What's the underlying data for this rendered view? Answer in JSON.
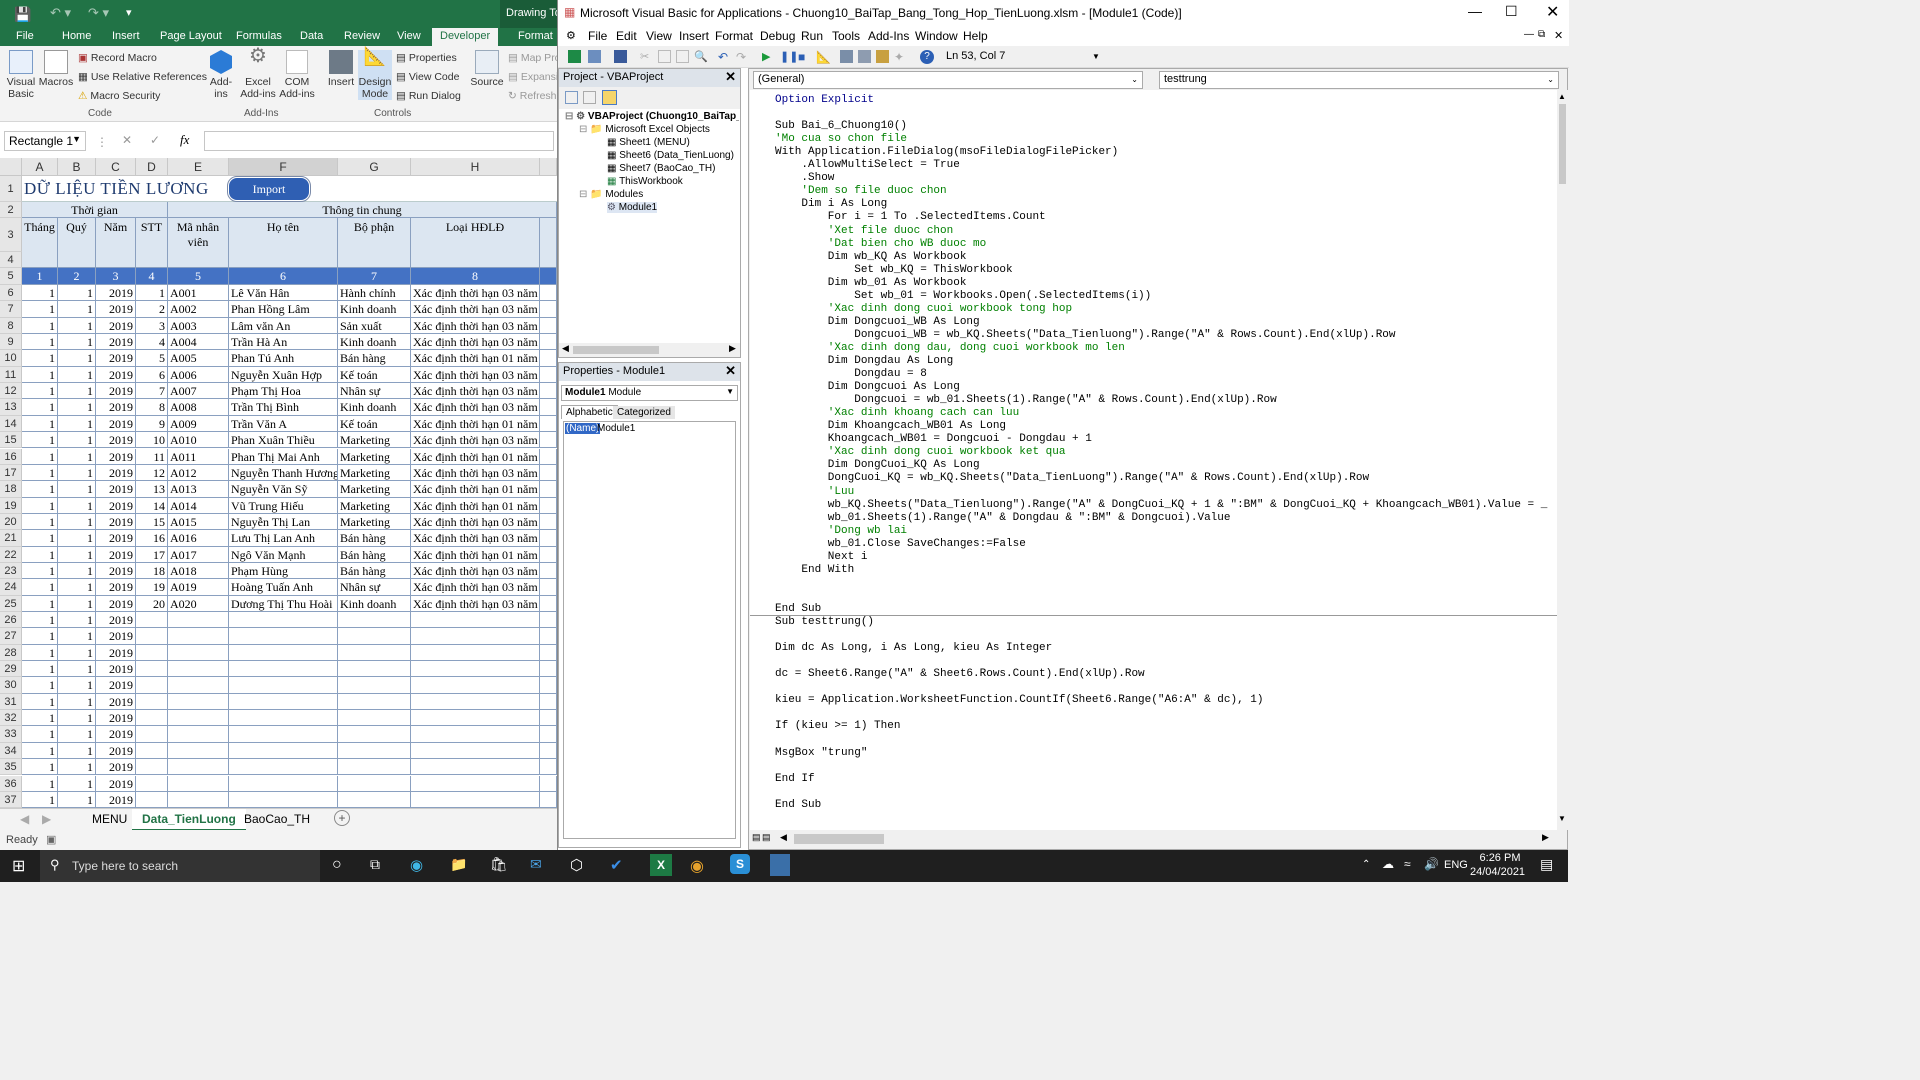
{
  "excel": {
    "title_partial": "Drawing To...",
    "tabs": [
      "File",
      "Home",
      "Insert",
      "Page Layout",
      "Formulas",
      "Data",
      "Review",
      "View",
      "Developer",
      "Format"
    ],
    "active_tab": "Developer",
    "ribbon": {
      "visual_basic": "Visual Basic",
      "macros": "Macros",
      "record_macro": "Record Macro",
      "relative_refs": "Use Relative References",
      "macro_security": "Macro Security",
      "group_code": "Code",
      "addins": "Add-ins",
      "excel_addins": "Excel Add-ins",
      "com_addins": "COM Add-ins",
      "group_addins": "Add-Ins",
      "insert": "Insert",
      "design_mode": "Design Mode",
      "properties": "Properties",
      "view_code": "View Code",
      "run_dialog": "Run Dialog",
      "group_controls": "Controls",
      "source": "Source",
      "map_props": "Map Pro",
      "expansion": "Expansi",
      "refresh": "Refresh"
    },
    "name_box": "Rectangle 1",
    "fx": "fx",
    "columns": [
      "A",
      "B",
      "C",
      "D",
      "E",
      "F",
      "G",
      "H"
    ],
    "sheet_title": "DỮ LIỆU TIỀN LƯƠNG",
    "import_button": "Import",
    "group_time": "Thời gian",
    "group_info": "Thông tin chung",
    "headers": [
      "Tháng",
      "Quý",
      "Năm",
      "STT",
      "Mã nhân viên",
      "Họ tên",
      "Bộ phận",
      "Loại HĐLĐ"
    ],
    "col_numbers": [
      "1",
      "2",
      "3",
      "4",
      "5",
      "6",
      "7",
      "8"
    ],
    "rows": [
      [
        "1",
        "1",
        "2019",
        "1",
        "A001",
        "Lê Văn Hân",
        "Hành chính",
        "Xác định thời hạn 03 năm"
      ],
      [
        "1",
        "1",
        "2019",
        "2",
        "A002",
        "Phan Hồng Lâm",
        "Kinh doanh",
        "Xác định thời hạn 03 năm"
      ],
      [
        "1",
        "1",
        "2019",
        "3",
        "A003",
        "Lâm văn An",
        "Sản xuất",
        "Xác định thời hạn 03 năm"
      ],
      [
        "1",
        "1",
        "2019",
        "4",
        "A004",
        "Trần Hà An",
        "Kinh doanh",
        "Xác định thời hạn 03 năm"
      ],
      [
        "1",
        "1",
        "2019",
        "5",
        "A005",
        "Phan Tú Anh",
        "Bán hàng",
        "Xác định thời hạn 01 năm"
      ],
      [
        "1",
        "1",
        "2019",
        "6",
        "A006",
        "Nguyễn Xuân Hợp",
        "Kế toán",
        "Xác định thời hạn 03 năm"
      ],
      [
        "1",
        "1",
        "2019",
        "7",
        "A007",
        "Phạm Thị Hoa",
        "Nhân sự",
        "Xác định thời hạn 03 năm"
      ],
      [
        "1",
        "1",
        "2019",
        "8",
        "A008",
        "Trần Thị Bình",
        "Kinh doanh",
        "Xác định thời hạn 03 năm"
      ],
      [
        "1",
        "1",
        "2019",
        "9",
        "A009",
        "Trần Văn A",
        "Kế toán",
        "Xác định thời hạn 01 năm"
      ],
      [
        "1",
        "1",
        "2019",
        "10",
        "A010",
        "Phan Xuân Thiều",
        "Marketing",
        "Xác định thời hạn 03 năm"
      ],
      [
        "1",
        "1",
        "2019",
        "11",
        "A011",
        "Phan Thị Mai Anh",
        "Marketing",
        "Xác định thời hạn 01 năm"
      ],
      [
        "1",
        "1",
        "2019",
        "12",
        "A012",
        "Nguyễn Thanh Hương",
        "Marketing",
        "Xác định thời hạn 03 năm"
      ],
      [
        "1",
        "1",
        "2019",
        "13",
        "A013",
        "Nguyễn Văn Sỹ",
        "Marketing",
        "Xác định thời hạn 01 năm"
      ],
      [
        "1",
        "1",
        "2019",
        "14",
        "A014",
        "Vũ Trung Hiếu",
        "Marketing",
        "Xác định thời hạn 01 năm"
      ],
      [
        "1",
        "1",
        "2019",
        "15",
        "A015",
        "Nguyễn Thị Lan",
        "Marketing",
        "Xác định thời hạn 03 năm"
      ],
      [
        "1",
        "1",
        "2019",
        "16",
        "A016",
        "Lưu Thị Lan Anh",
        "Bán hàng",
        "Xác định thời hạn 03 năm"
      ],
      [
        "1",
        "1",
        "2019",
        "17",
        "A017",
        "Ngô Văn Mạnh",
        "Bán hàng",
        "Xác định thời hạn 01 năm"
      ],
      [
        "1",
        "1",
        "2019",
        "18",
        "A018",
        "Phạm Hùng",
        "Bán hàng",
        "Xác định thời hạn 03 năm"
      ],
      [
        "1",
        "1",
        "2019",
        "19",
        "A019",
        "Hoàng Tuấn Anh",
        "Nhân sự",
        "Xác định thời hạn 03 năm"
      ],
      [
        "1",
        "1",
        "2019",
        "20",
        "A020",
        "Dương Thị Thu Hoài",
        "Kinh doanh",
        "Xác định thời hạn 03 năm"
      ],
      [
        "1",
        "1",
        "2019",
        "",
        "",
        "",
        "",
        ""
      ],
      [
        "1",
        "1",
        "2019",
        "",
        "",
        "",
        "",
        ""
      ],
      [
        "1",
        "1",
        "2019",
        "",
        "",
        "",
        "",
        ""
      ],
      [
        "1",
        "1",
        "2019",
        "",
        "",
        "",
        "",
        ""
      ],
      [
        "1",
        "1",
        "2019",
        "",
        "",
        "",
        "",
        ""
      ],
      [
        "1",
        "1",
        "2019",
        "",
        "",
        "",
        "",
        ""
      ],
      [
        "1",
        "1",
        "2019",
        "",
        "",
        "",
        "",
        ""
      ],
      [
        "1",
        "1",
        "2019",
        "",
        "",
        "",
        "",
        ""
      ],
      [
        "1",
        "1",
        "2019",
        "",
        "",
        "",
        "",
        ""
      ],
      [
        "1",
        "1",
        "2019",
        "",
        "",
        "",
        "",
        ""
      ],
      [
        "1",
        "1",
        "2019",
        "",
        "",
        "",
        "",
        ""
      ],
      [
        "1",
        "1",
        "2019",
        "",
        "",
        "",
        "",
        ""
      ]
    ],
    "row_numbers": [
      "1",
      "2",
      "3",
      "4",
      "5",
      "6",
      "7",
      "8",
      "9",
      "10",
      "11",
      "12",
      "13",
      "14",
      "15",
      "16",
      "17",
      "18",
      "19",
      "20",
      "21",
      "22",
      "23",
      "24",
      "25",
      "26",
      "27",
      "28",
      "29",
      "30",
      "31",
      "32",
      "33",
      "34",
      "35",
      "36",
      "37"
    ],
    "sheet_tabs": [
      "MENU",
      "Data_TienLuong",
      "BaoCao_TH"
    ],
    "active_sheet": "Data_TienLuong",
    "status": "Ready"
  },
  "vba": {
    "title": "Microsoft Visual Basic for Applications - Chuong10_BaiTap_Bang_Tong_Hop_TienLuong.xlsm - [Module1 (Code)]",
    "menu": [
      "File",
      "Edit",
      "View",
      "Insert",
      "Format",
      "Debug",
      "Run",
      "Tools",
      "Add-Ins",
      "Window",
      "Help"
    ],
    "cursor_pos": "Ln 53, Col 7",
    "project_title": "Project - VBAProject",
    "tree": {
      "root": "VBAProject (Chuong10_BaiTap_",
      "objects_folder": "Microsoft Excel Objects",
      "sheets": [
        "Sheet1 (MENU)",
        "Sheet6 (Data_TienLuong)",
        "Sheet7 (BaoCao_TH)",
        "ThisWorkbook"
      ],
      "modules_folder": "Modules",
      "module": "Module1"
    },
    "props_title": "Properties - Module1",
    "props_combo_bold": "Module1",
    "props_combo_rest": "Module",
    "props_tabs": [
      "Alphabetic",
      "Categorized"
    ],
    "props_name_key": "(Name)",
    "props_name_val": "Module1",
    "combo_left": "(General)",
    "combo_right": "testtrung",
    "code_lines": [
      {
        "t": "Option Explicit",
        "c": "kw"
      },
      {
        "t": "",
        "c": ""
      },
      {
        "t": "Sub Bai_6_Chuong10()",
        "c": ""
      },
      {
        "t": "'Mo cua so chon file",
        "c": "cm"
      },
      {
        "t": "With Application.FileDialog(msoFileDialogFilePicker)",
        "c": ""
      },
      {
        "t": "    .AllowMultiSelect = True",
        "c": ""
      },
      {
        "t": "    .Show",
        "c": ""
      },
      {
        "t": "    'Dem so file duoc chon",
        "c": "cm"
      },
      {
        "t": "    Dim i As Long",
        "c": ""
      },
      {
        "t": "        For i = 1 To .SelectedItems.Count",
        "c": ""
      },
      {
        "t": "        'Xet file duoc chon",
        "c": "cm"
      },
      {
        "t": "        'Dat bien cho WB duoc mo",
        "c": "cm"
      },
      {
        "t": "        Dim wb_KQ As Workbook",
        "c": ""
      },
      {
        "t": "            Set wb_KQ = ThisWorkbook",
        "c": ""
      },
      {
        "t": "        Dim wb_01 As Workbook",
        "c": ""
      },
      {
        "t": "            Set wb_01 = Workbooks.Open(.SelectedItems(i))",
        "c": ""
      },
      {
        "t": "        'Xac dinh dong cuoi workbook tong hop",
        "c": "cm"
      },
      {
        "t": "        Dim Dongcuoi_WB As Long",
        "c": ""
      },
      {
        "t": "            Dongcuoi_WB = wb_KQ.Sheets(\"Data_Tienluong\").Range(\"A\" & Rows.Count).End(xlUp).Row",
        "c": ""
      },
      {
        "t": "        'Xac dinh dong dau, dong cuoi workbook mo len",
        "c": "cm"
      },
      {
        "t": "        Dim Dongdau As Long",
        "c": ""
      },
      {
        "t": "            Dongdau = 8",
        "c": ""
      },
      {
        "t": "        Dim Dongcuoi As Long",
        "c": ""
      },
      {
        "t": "            Dongcuoi = wb_01.Sheets(1).Range(\"A\" & Rows.Count).End(xlUp).Row",
        "c": ""
      },
      {
        "t": "        'Xac dinh khoang cach can luu",
        "c": "cm"
      },
      {
        "t": "        Dim Khoangcach_WB01 As Long",
        "c": ""
      },
      {
        "t": "        Khoangcach_WB01 = Dongcuoi - Dongdau + 1",
        "c": ""
      },
      {
        "t": "        'Xac dinh dong cuoi workbook ket qua",
        "c": "cm"
      },
      {
        "t": "        Dim DongCuoi_KQ As Long",
        "c": ""
      },
      {
        "t": "        DongCuoi_KQ = wb_KQ.Sheets(\"Data_TienLuong\").Range(\"A\" & Rows.Count).End(xlUp).Row",
        "c": ""
      },
      {
        "t": "        'Luu",
        "c": "cm"
      },
      {
        "t": "        wb_KQ.Sheets(\"Data_Tienluong\").Range(\"A\" & DongCuoi_KQ + 1 & \":BM\" & DongCuoi_KQ + Khoangcach_WB01).Value = _",
        "c": ""
      },
      {
        "t": "        wb_01.Sheets(1).Range(\"A\" & Dongdau & \":BM\" & Dongcuoi).Value",
        "c": ""
      },
      {
        "t": "        'Dong wb lai",
        "c": "cm"
      },
      {
        "t": "        wb_01.Close SaveChanges:=False",
        "c": ""
      },
      {
        "t": "        Next i",
        "c": ""
      },
      {
        "t": "    End With",
        "c": ""
      },
      {
        "t": "",
        "c": ""
      },
      {
        "t": "",
        "c": ""
      },
      {
        "t": "End Sub",
        "c": ""
      },
      {
        "t": "Sub testtrung()",
        "c": ""
      },
      {
        "t": "",
        "c": ""
      },
      {
        "t": "Dim dc As Long, i As Long, kieu As Integer",
        "c": ""
      },
      {
        "t": "",
        "c": ""
      },
      {
        "t": "dc = Sheet6.Range(\"A\" & Sheet6.Rows.Count).End(xlUp).Row",
        "c": ""
      },
      {
        "t": "",
        "c": ""
      },
      {
        "t": "kieu = Application.WorksheetFunction.CountIf(Sheet6.Range(\"A6:A\" & dc), 1)",
        "c": ""
      },
      {
        "t": "",
        "c": ""
      },
      {
        "t": "If (kieu >= 1) Then",
        "c": ""
      },
      {
        "t": "",
        "c": ""
      },
      {
        "t": "MsgBox \"trung\"",
        "c": ""
      },
      {
        "t": "",
        "c": ""
      },
      {
        "t": "End If",
        "c": ""
      },
      {
        "t": "",
        "c": ""
      },
      {
        "t": "End Sub",
        "c": ""
      }
    ]
  },
  "taskbar": {
    "search_placeholder": "Type here to search",
    "lang": "ENG",
    "time": "6:26 PM",
    "date": "24/04/2021"
  }
}
